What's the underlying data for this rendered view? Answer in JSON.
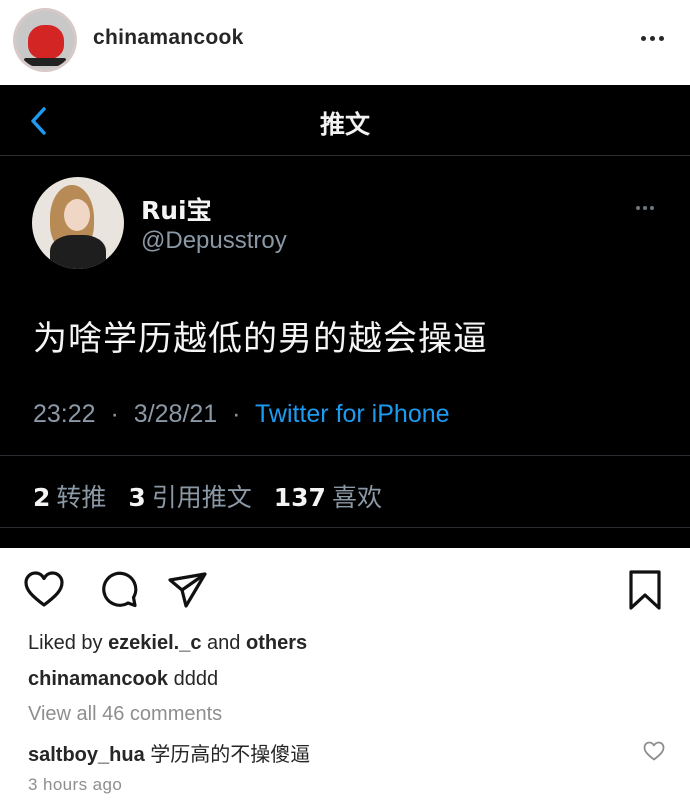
{
  "post": {
    "username": "chinamancook",
    "avatar_icon": "profile-avatar",
    "more_icon": "more-horizontal-icon"
  },
  "tweet": {
    "nav_title": "推文",
    "back_icon": "chevron-left-icon",
    "display_name": "Rui宝",
    "handle": "@Depusstroy",
    "text": "为啥学历越低的男的越会操逼",
    "time": "23:22",
    "date": "3/28/21",
    "separator": "·",
    "source": "Twitter for iPhone",
    "stats": {
      "retweets_count": "2",
      "retweets_label": "转推",
      "quotes_count": "3",
      "quotes_label": "引用推文",
      "likes_count": "137",
      "likes_label": "喜欢"
    },
    "colors": {
      "background": "#000000",
      "link": "#1d9bf0",
      "muted": "#8b98a5"
    }
  },
  "actions": {
    "like_icon": "heart-icon",
    "comment_icon": "comment-icon",
    "share_icon": "paper-plane-icon",
    "save_icon": "bookmark-icon"
  },
  "likes": {
    "prefix": "Liked by",
    "user": "ezekiel._c",
    "connector": "and",
    "others": "others"
  },
  "caption": {
    "user": "chinamancook",
    "text": "dddd"
  },
  "comments": {
    "view_all": "View all 46 comments",
    "items": [
      {
        "user": "saltboy_hua",
        "text": "学历高的不操傻逼"
      }
    ]
  },
  "timestamp": "3 hours ago"
}
